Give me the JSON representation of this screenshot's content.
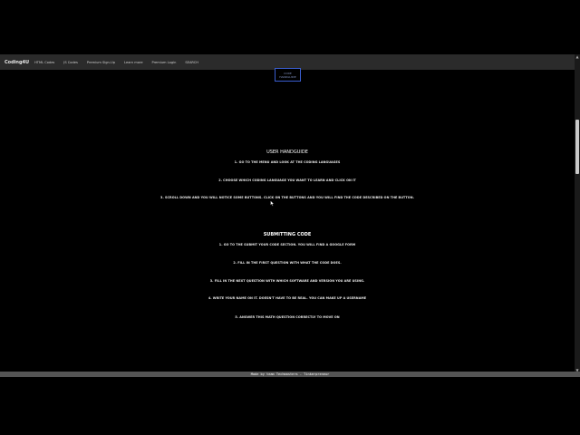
{
  "nav": {
    "brand": "Coding4U",
    "links": [
      "HTML Codes",
      "JS Codes",
      "Premium Sign-Up",
      "Learn more",
      "Premium Login",
      "SEARCH"
    ]
  },
  "code_button": {
    "line1": "CODE",
    "line2": "HANDGUIDE"
  },
  "user_handguide": {
    "title": "USER HANDGUIDE",
    "steps": [
      "1. GO TO THE MENU AND LOOK AT THE CODING LANGUAGES",
      "2. CHOOSE WHICH CODING LANGUAGE YOU WANT TO LEARN AND CLICK ON IT",
      "3. SCROLL DOWN AND YOU WILL NOTICE SOME BUTTONS. CLICK ON THE BUTTONS AND YOU WILL FIND THE CODE DESCRIBED ON THE BUTTON."
    ]
  },
  "submitting_code": {
    "title": "SUBMITTING CODE",
    "steps": [
      "1. GO TO THE SUBMIT YOUR CODE SECTION. YOU WILL FIND A GOOGLE FORM",
      "2. FILL IN THE FIRST QUESTION WITH WHAT THE CODE DOES.",
      "3. FILL IN THE NEXT QUESTION WITH WHICH SOFTWARE AND VERSION YOU ARE USING.",
      "4. WRITE YOUR NAME ON IT. DOESN'T HAVE TO BE REAL. YOU CAN MAKE UP A USERNAME",
      "5. ANSWER THIS MATH QUESTION CORRECTLY TO MOVE ON"
    ]
  },
  "footer": {
    "text": "Made by team Techmasters - Tinkerpreneur"
  },
  "colors": {
    "navbar": "#2b2b2b",
    "button_border": "#3a5ed0",
    "footer": "#555555"
  }
}
